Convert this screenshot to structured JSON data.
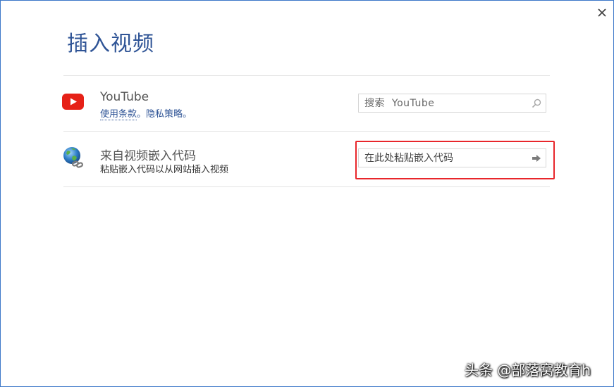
{
  "dialog": {
    "title": "插入视频",
    "close_glyph": "✕"
  },
  "youtube": {
    "name": "YouTube",
    "terms_link": "使用条款",
    "separator": "。",
    "privacy_link": "隐私策略",
    "end_punct": "。",
    "search_placeholder": "搜索  YouTube",
    "icon": "youtube-play-icon",
    "brand_color": "#e62117"
  },
  "embed": {
    "name": "来自视频嵌入代码",
    "description": "粘贴嵌入代码以从网站插入视频",
    "input_placeholder": "在此处粘贴嵌入代码",
    "icon": "globe-link-icon"
  },
  "watermark": {
    "text": "头条 @部落窝教育h"
  },
  "colors": {
    "title": "#2f5496",
    "link": "#2f5496",
    "highlight": "#e8262b",
    "border": "#3c78c8"
  }
}
